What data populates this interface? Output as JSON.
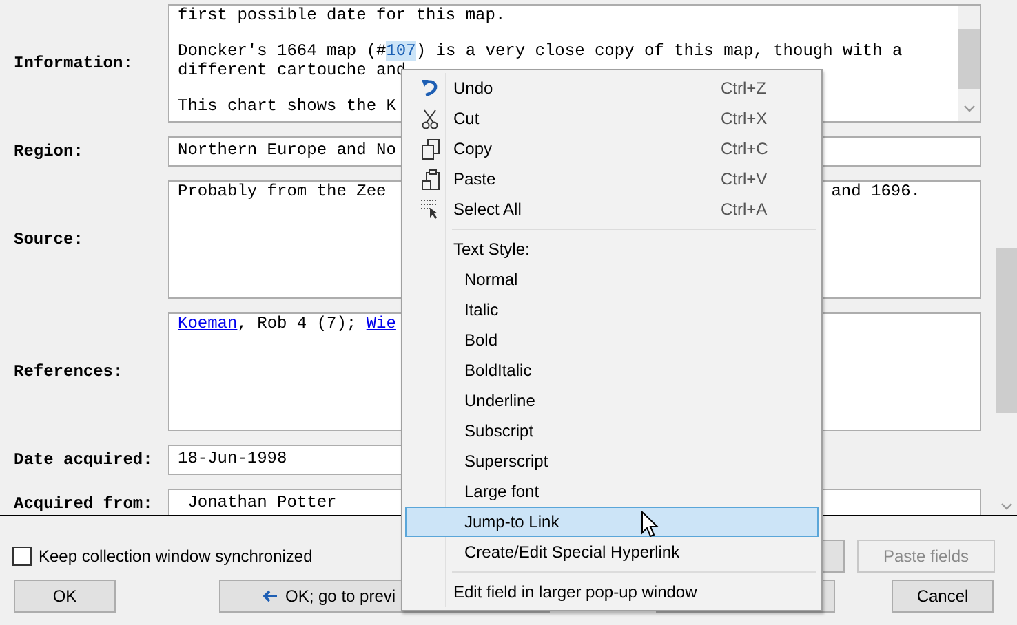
{
  "form": {
    "fields": [
      {
        "label": "Information:",
        "kind": "multiline",
        "scrollbar": true,
        "paragraphs": [
          [
            [
              {
                "kind": "text",
                "text": "first possible date for this map.",
                "selected": false
              }
            ]
          ],
          [
            [
              {
                "kind": "text",
                "text": "Doncker's 1664 map (#",
                "selected": false
              },
              {
                "kind": "text",
                "text": "107",
                "selected": true
              },
              {
                "kind": "text",
                "text": ") is a very close copy of this map, though with a",
                "selected": false
              }
            ],
            [
              {
                "kind": "text",
                "text": "different cartouche and",
                "selected": false
              }
            ]
          ],
          [
            [
              {
                "kind": "text",
                "text": "This chart shows the K",
                "selected": false
              }
            ]
          ]
        ]
      },
      {
        "label": "Region:",
        "kind": "line",
        "paragraphs": [
          [
            [
              {
                "kind": "text",
                "text": "Northern Europe and No",
                "selected": false
              }
            ]
          ]
        ]
      },
      {
        "label": "Source:",
        "kind": "multiline",
        "paragraphs": [
          [
            [
              {
                "kind": "text",
                "text": "Probably from the Zee",
                "selected": false
              },
              {
                "kind": "tail",
                "text": "and 1696.",
                "selected": false
              }
            ]
          ]
        ]
      },
      {
        "label": "References:",
        "kind": "multiline",
        "paragraphs": [
          [
            [
              {
                "kind": "link",
                "text": "Koeman",
                "selected": false
              },
              {
                "kind": "text",
                "text": ", Rob 4 (7); ",
                "selected": false
              },
              {
                "kind": "link",
                "text": "Wie",
                "selected": false
              }
            ]
          ]
        ]
      },
      {
        "label": "Date acquired:",
        "kind": "short",
        "paragraphs": [
          [
            [
              {
                "kind": "text",
                "text": "18-Jun-1998",
                "selected": false
              }
            ]
          ]
        ]
      },
      {
        "label": "Acquired from:",
        "kind": "line",
        "paragraphs": [
          [
            [
              {
                "kind": "text",
                "text": " Jonathan Potter",
                "selected": false
              }
            ]
          ]
        ]
      }
    ]
  },
  "sync_checkbox": {
    "label": "Keep collection window synchronized",
    "checked": false
  },
  "paste_button": {
    "label": "Paste fields",
    "disabled": true
  },
  "buttons": [
    {
      "label": "OK",
      "kind": "plain"
    },
    {
      "label": "OK; go to previ",
      "kind": "back"
    },
    {
      "label": "Cancel",
      "kind": "plain"
    }
  ],
  "context_menu": {
    "groups": [
      [
        {
          "kind": "undo",
          "label": "Undo",
          "shortcut": "Ctrl+Z",
          "selected": false
        },
        {
          "kind": "cut",
          "label": "Cut",
          "shortcut": "Ctrl+X",
          "selected": false
        },
        {
          "kind": "copy",
          "label": "Copy",
          "shortcut": "Ctrl+C",
          "selected": false
        },
        {
          "kind": "paste",
          "label": "Paste",
          "shortcut": "Ctrl+V",
          "selected": false
        },
        {
          "kind": "selectall",
          "label": "Select All",
          "shortcut": "Ctrl+A",
          "selected": false
        }
      ],
      [
        {
          "kind": "heading",
          "label": "Text Style:",
          "selected": false
        },
        {
          "kind": "style",
          "label": "Normal",
          "selected": false
        },
        {
          "kind": "style",
          "label": "Italic",
          "selected": false
        },
        {
          "kind": "style",
          "label": "Bold",
          "selected": false
        },
        {
          "kind": "style",
          "label": "BoldItalic",
          "selected": false
        },
        {
          "kind": "style",
          "label": "Underline",
          "selected": false
        },
        {
          "kind": "style",
          "label": "Subscript",
          "selected": false
        },
        {
          "kind": "style",
          "label": "Superscript",
          "selected": false
        },
        {
          "kind": "style",
          "label": "Large font",
          "selected": false
        },
        {
          "kind": "style",
          "label": "Jump-to Link",
          "selected": true
        },
        {
          "kind": "style",
          "label": "Create/Edit Special Hyperlink",
          "selected": false
        }
      ],
      [
        {
          "kind": "command",
          "label": "Edit field in larger pop-up window",
          "selected": false
        }
      ]
    ]
  }
}
